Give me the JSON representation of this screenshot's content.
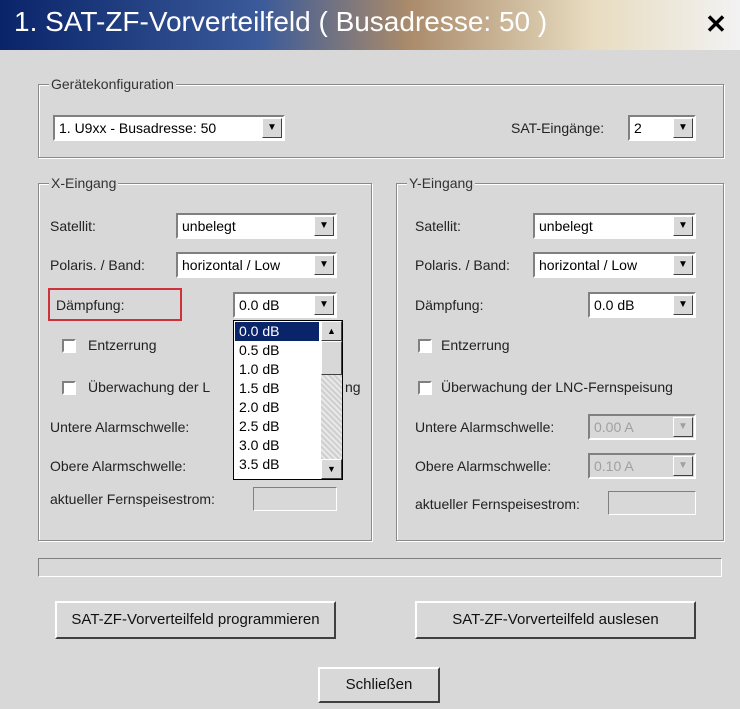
{
  "window": {
    "title": "1. SAT-ZF-Vorverteilfeld ( Busadresse: 50 )",
    "close_glyph": "✕"
  },
  "geraet": {
    "legend": "Gerätekonfiguration",
    "device_value": "1. U9xx - Busadresse: 50",
    "sat_label": "SAT-Eingänge:",
    "sat_value": "2"
  },
  "x": {
    "legend": "X-Eingang",
    "satellit_label": "Satellit:",
    "satellit_value": "unbelegt",
    "polaris_label": "Polaris. / Band:",
    "polaris_value": "horizontal / Low",
    "daempfung_label": "Dämpfung:",
    "daempfung_value": "0.0 dB",
    "entzerrung_label": "Entzerrung",
    "ueberwachung_label": "Überwachung der L",
    "ueberwachung_tail": "ng",
    "untere_label": "Untere Alarmschwelle:",
    "obere_label": "Obere Alarmschwelle:",
    "strom_label": "aktueller Fernspeisestrom:",
    "dropdown_options": [
      "0.0 dB",
      "0.5 dB",
      "1.0 dB",
      "1.5 dB",
      "2.0 dB",
      "2.5 dB",
      "3.0 dB",
      "3.5 dB"
    ],
    "dropdown_selected": "0.0 dB"
  },
  "y": {
    "legend": "Y-Eingang",
    "satellit_label": "Satellit:",
    "satellit_value": "unbelegt",
    "polaris_label": "Polaris. / Band:",
    "polaris_value": "horizontal / Low",
    "daempfung_label": "Dämpfung:",
    "daempfung_value": "0.0 dB",
    "entzerrung_label": "Entzerrung",
    "ueberwachung_label": "Überwachung der LNC-Fernspeisung",
    "untere_label": "Untere Alarmschwelle:",
    "untere_value": "0.00 A",
    "obere_label": "Obere Alarmschwelle:",
    "obere_value": "0.10 A",
    "strom_label": "aktueller Fernspeisestrom:"
  },
  "buttons": {
    "program": "SAT-ZF-Vorverteilfeld programmieren",
    "read": "SAT-ZF-Vorverteilfeld auslesen",
    "close": "Schließen"
  },
  "icons": {
    "combo_arrow": "▼",
    "scroll_up": "▲",
    "scroll_down": "▼"
  }
}
